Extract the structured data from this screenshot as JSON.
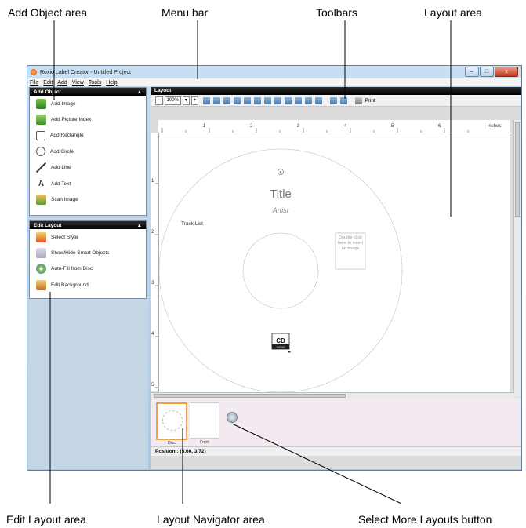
{
  "callouts": {
    "add_object_area": "Add Object area",
    "menu_bar": "Menu bar",
    "toolbars": "Toolbars",
    "layout_area": "Layout area",
    "edit_layout_area": "Edit Layout area",
    "layout_navigator_area": "Layout Navigator area",
    "select_more_layouts_button": "Select More Layouts button"
  },
  "window": {
    "title": "Roxio Label Creator - Untitled Project",
    "controls": {
      "minimize": "–",
      "maximize": "□",
      "close": "x"
    }
  },
  "menu": [
    "File",
    "Edit",
    "Add",
    "View",
    "Tools",
    "Help"
  ],
  "add_object": {
    "header": "Add Object",
    "items": [
      "Add Image",
      "Add Picture Index",
      "Add Rectangle",
      "Add Circle",
      "Add Line",
      "Add Text",
      "Scan Image"
    ]
  },
  "edit_layout": {
    "header": "Edit Layout",
    "items": [
      "Select Style",
      "Show/Hide Smart Objects",
      "Auto-Fill from Disc",
      "Edit Background"
    ]
  },
  "layout": {
    "header": "Layout",
    "zoom": "100%",
    "print_label": "Print",
    "ruler_top": [
      "1",
      "2",
      "3",
      "4",
      "5",
      "6"
    ],
    "ruler_unit": "inches",
    "ruler_left": [
      "1",
      "2",
      "3",
      "4",
      "5"
    ],
    "disc": {
      "title": "Title",
      "artist": "Artist",
      "track_list": "Track List",
      "image_placeholder": "Double-click here to insert an image",
      "cd_logo": "CD",
      "cd_logo_sub": "AUDIO"
    }
  },
  "navigator": {
    "thumbs": [
      "Disc",
      "Front"
    ]
  },
  "status": "Position : (5.60, 3.72)"
}
